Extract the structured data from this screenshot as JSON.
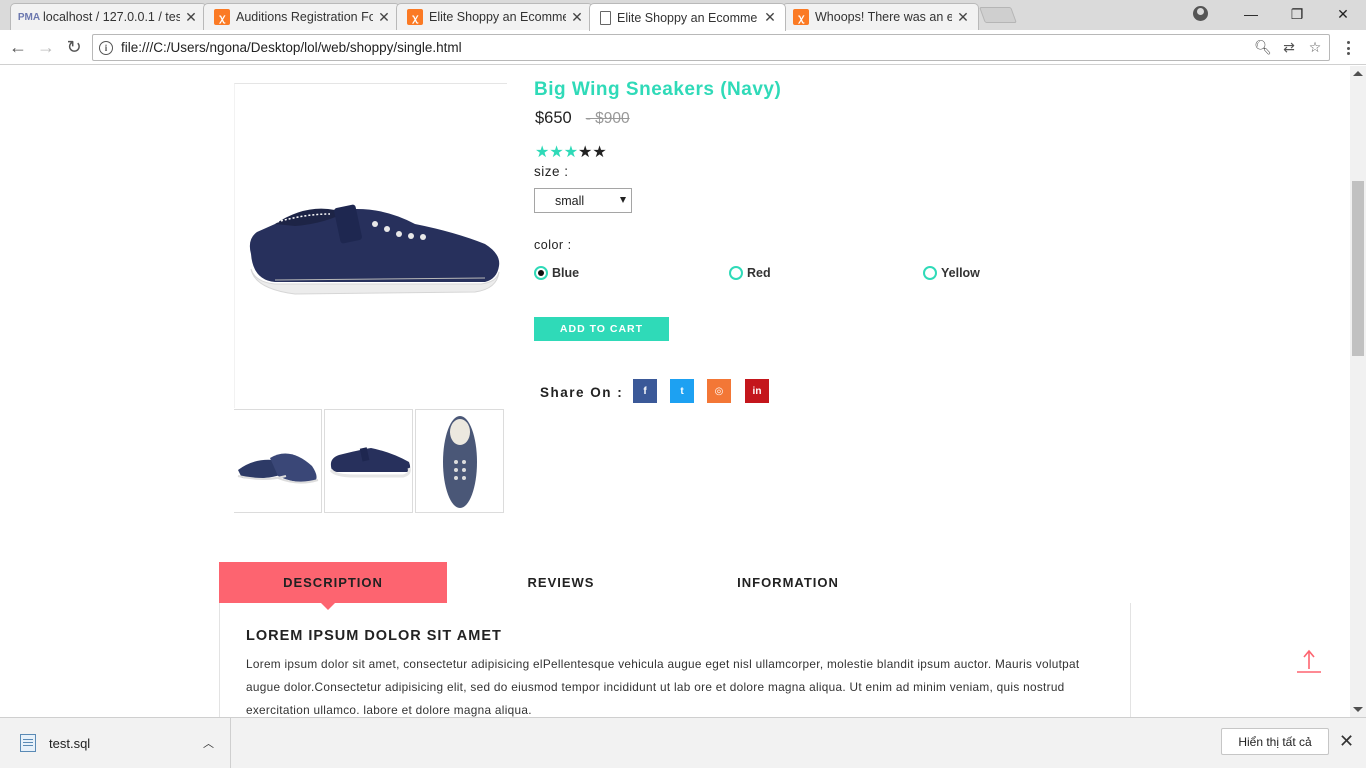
{
  "browser": {
    "tabs": [
      {
        "title": "localhost / 127.0.0.1 / tes",
        "favicon": "phpmyadmin-icon",
        "active": false
      },
      {
        "title": "Auditions Registration Fo",
        "favicon": "xampp-icon",
        "active": false
      },
      {
        "title": "Elite Shoppy an Ecomme",
        "favicon": "xampp-icon",
        "active": false
      },
      {
        "title": "Elite Shoppy an Ecomme",
        "favicon": "document-icon",
        "active": true
      },
      {
        "title": "Whoops! There was an e",
        "favicon": "xampp-icon",
        "active": false
      }
    ],
    "url": "file:///C:/Users/ngona/Desktop/lol/web/shoppy/single.html"
  },
  "product": {
    "title": "Big Wing Sneakers (Navy)",
    "price": "$650",
    "old_price": "- $900",
    "rating": 3,
    "rating_max": 5,
    "size_label": "size :",
    "size_selected": "small",
    "color_label": "color :",
    "colors": [
      {
        "label": "Blue",
        "checked": true
      },
      {
        "label": "Red",
        "checked": false
      },
      {
        "label": "Yellow",
        "checked": false
      }
    ],
    "add_to_cart": "ADD TO CART",
    "share_label": "Share On :",
    "social": [
      {
        "glyph": "f",
        "name": "facebook-icon",
        "color": "#3b5998"
      },
      {
        "glyph": "t",
        "name": "twitter-icon",
        "color": "#1da1f2"
      },
      {
        "glyph": "◎",
        "name": "instagram-icon",
        "color": "#f37736"
      },
      {
        "glyph": "in",
        "name": "linkedin-icon",
        "color": "#c4161c"
      }
    ]
  },
  "tabs": {
    "items": [
      "DESCRIPTION",
      "REVIEWS",
      "INFORMATION"
    ],
    "active": 0,
    "heading": "LOREM IPSUM DOLOR SIT AMET",
    "text": "Lorem ipsum dolor sit amet, consectetur adipisicing elPellentesque vehicula augue eget nisl ullamcorper, molestie blandit ipsum auctor. Mauris volutpat augue dolor.Consectetur adipisicing elit, sed do eiusmod tempor incididunt ut lab ore et dolore magna aliqua. Ut enim ad minim veniam, quis nostrud exercitation ullamco. labore et dolore magna aliqua."
  },
  "downloads": {
    "file": "test.sql",
    "show_all": "Hiển thị tất cả"
  },
  "colors": {
    "accent": "#2fdab8",
    "tab_active": "#fd6470",
    "product_navy": "#27305c"
  }
}
